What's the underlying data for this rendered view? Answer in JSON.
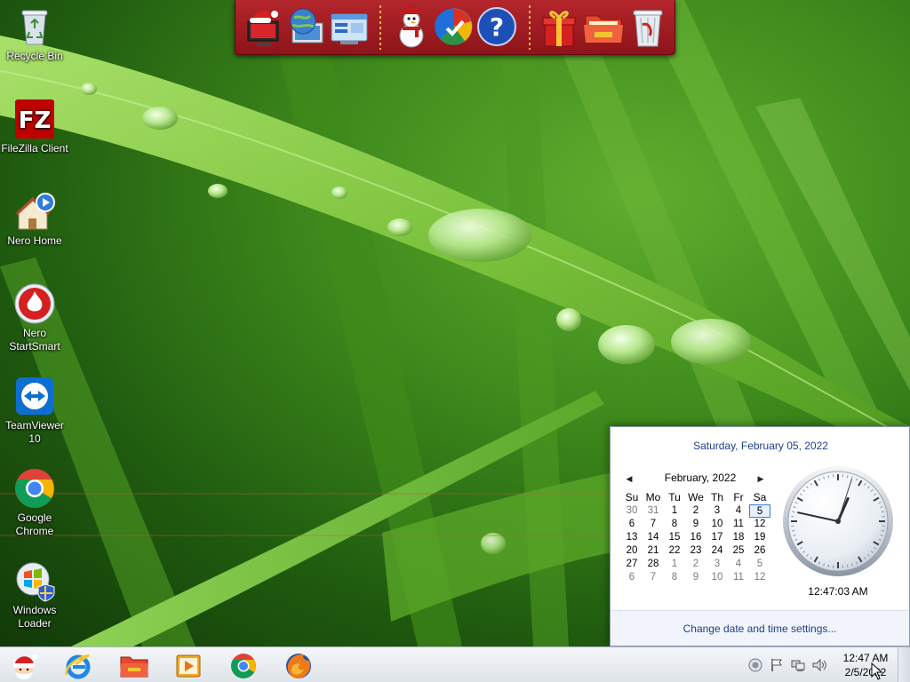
{
  "desktop": {
    "icons": [
      {
        "label": "Recycle Bin",
        "icon": "recycle-bin-icon"
      },
      {
        "label": "FileZilla Client",
        "icon": "filezilla-icon"
      },
      {
        "label": "Nero Home",
        "icon": "nero-home-icon"
      },
      {
        "label": "Nero StartSmart",
        "icon": "nero-startsmart-icon"
      },
      {
        "label": "TeamViewer 10",
        "icon": "teamviewer-icon"
      },
      {
        "label": "Google Chrome",
        "icon": "chrome-icon"
      },
      {
        "label": "Windows Loader",
        "icon": "windows-loader-icon"
      }
    ]
  },
  "dock": {
    "items": [
      "christmas-computer-icon",
      "internet-globe-icon",
      "control-panel-icon",
      "snowman-icon",
      "color-wheel-icon",
      "help-icon",
      "gift-icon",
      "folder-icon",
      "trash-icon"
    ],
    "colors": {
      "bar": "#a61c22",
      "separator": "#e9b24a"
    }
  },
  "flyout": {
    "full_date": "Saturday, February 05, 2022",
    "month_label": "February, 2022",
    "weekdays": [
      "Su",
      "Mo",
      "Tu",
      "We",
      "Th",
      "Fr",
      "Sa"
    ],
    "weeks": [
      [
        {
          "d": "30",
          "o": true
        },
        {
          "d": "31",
          "o": true
        },
        {
          "d": "1"
        },
        {
          "d": "2"
        },
        {
          "d": "3"
        },
        {
          "d": "4"
        },
        {
          "d": "5",
          "today": true
        }
      ],
      [
        {
          "d": "6"
        },
        {
          "d": "7"
        },
        {
          "d": "8"
        },
        {
          "d": "9"
        },
        {
          "d": "10"
        },
        {
          "d": "11"
        },
        {
          "d": "12"
        }
      ],
      [
        {
          "d": "13"
        },
        {
          "d": "14"
        },
        {
          "d": "15"
        },
        {
          "d": "16"
        },
        {
          "d": "17"
        },
        {
          "d": "18"
        },
        {
          "d": "19"
        }
      ],
      [
        {
          "d": "20"
        },
        {
          "d": "21"
        },
        {
          "d": "22"
        },
        {
          "d": "23"
        },
        {
          "d": "24"
        },
        {
          "d": "25"
        },
        {
          "d": "26"
        }
      ],
      [
        {
          "d": "27"
        },
        {
          "d": "28"
        },
        {
          "d": "1",
          "o": true
        },
        {
          "d": "2",
          "o": true
        },
        {
          "d": "3",
          "o": true
        },
        {
          "d": "4",
          "o": true
        },
        {
          "d": "5",
          "o": true
        }
      ],
      [
        {
          "d": "6",
          "o": true
        },
        {
          "d": "7",
          "o": true
        },
        {
          "d": "8",
          "o": true
        },
        {
          "d": "9",
          "o": true
        },
        {
          "d": "10",
          "o": true
        },
        {
          "d": "11",
          "o": true
        },
        {
          "d": "12",
          "o": true
        }
      ]
    ],
    "time": "12:47:03 AM",
    "clock": {
      "hours": 0,
      "minutes": 47,
      "seconds": 3
    },
    "link": "Change date and time settings...",
    "colors": {
      "link": "#1e3d8c",
      "today_border": "#3d7bd6"
    }
  },
  "taskbar": {
    "apps": [
      "santa-start-icon",
      "internet-explorer-icon",
      "folder-taskbar-icon",
      "media-player-icon",
      "chrome-taskbar-icon",
      "firefox-icon"
    ],
    "tray": [
      "network-status-icon",
      "action-center-flag-icon",
      "network-icon",
      "volume-icon"
    ],
    "time": "12:47 AM",
    "date": "2/5/2022"
  }
}
